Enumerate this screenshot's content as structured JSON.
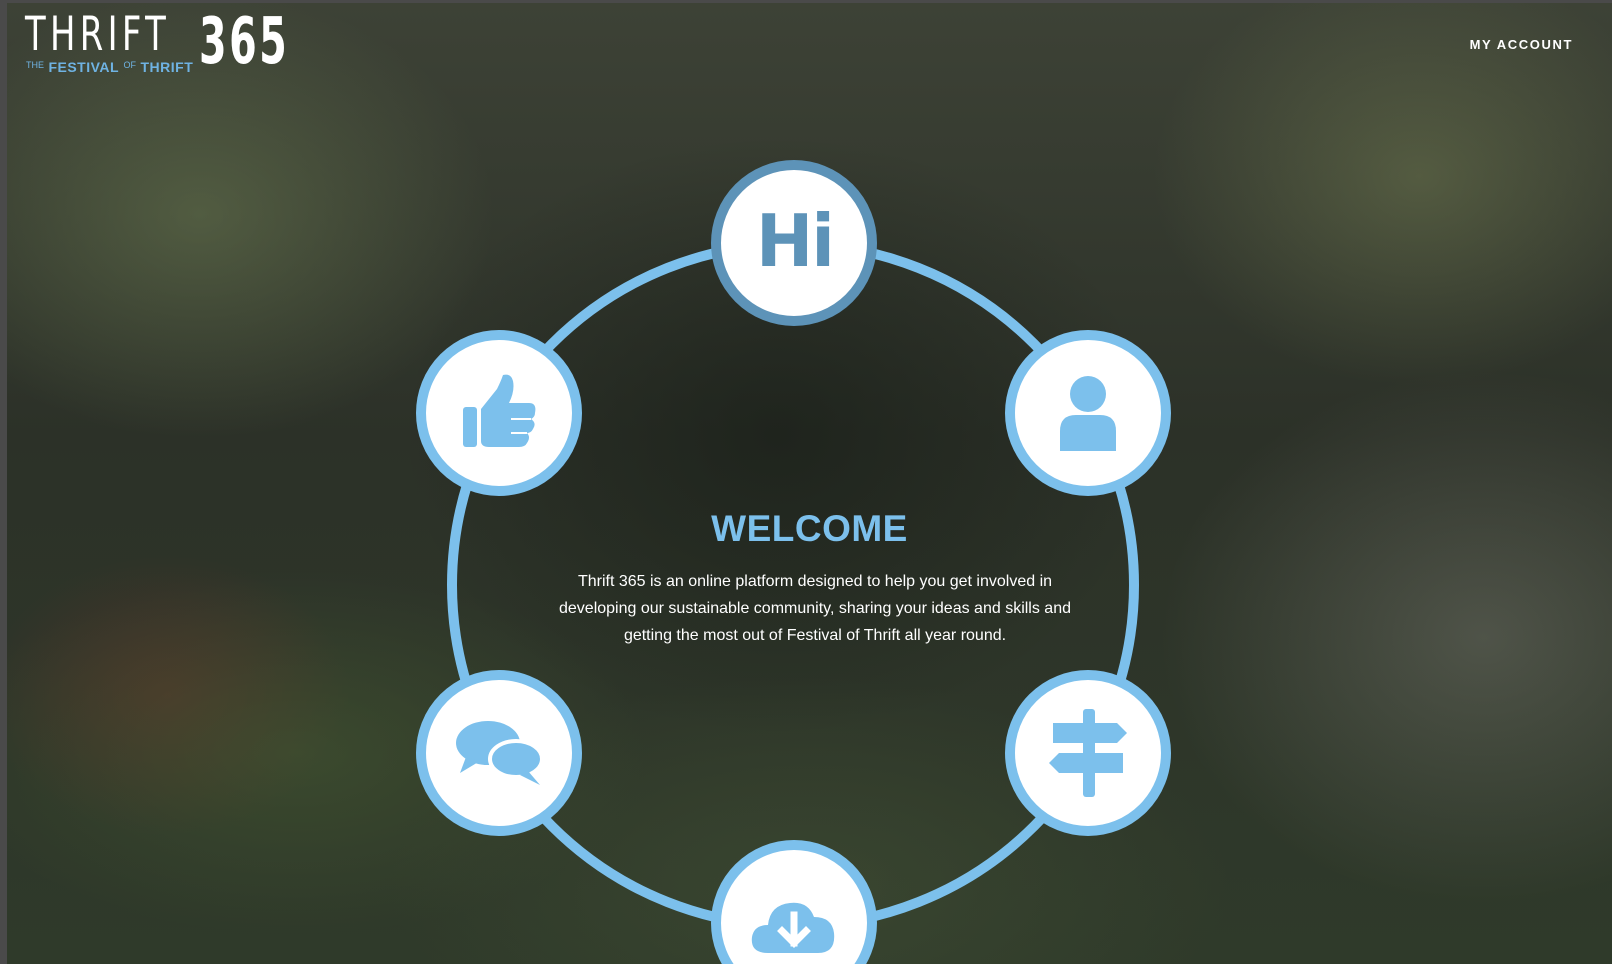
{
  "header": {
    "logo": {
      "wordmark": "THRIFT",
      "number": "365",
      "tagline_the": "THE",
      "tagline_festival": "FESTIVAL",
      "tagline_of": "OF",
      "tagline_thrift": "THRIFT"
    },
    "account_link": "MY ACCOUNT"
  },
  "ring": {
    "hi_label": "Hi",
    "nodes": [
      {
        "icon": "hi-icon"
      },
      {
        "icon": "user-icon"
      },
      {
        "icon": "signpost-icon"
      },
      {
        "icon": "cloud-download-icon"
      },
      {
        "icon": "chat-bubbles-icon"
      },
      {
        "icon": "thumbs-up-icon"
      }
    ]
  },
  "welcome": {
    "title": "WELCOME",
    "body": "Thrift 365 is an online platform designed to help you get involved in developing our sustainable community, sharing your ideas and skills and getting the most out of Festival of Thrift all year round."
  },
  "colors": {
    "accent": "#7cc0ec",
    "hi_accent": "#5d93b8",
    "text": "#ffffff"
  }
}
